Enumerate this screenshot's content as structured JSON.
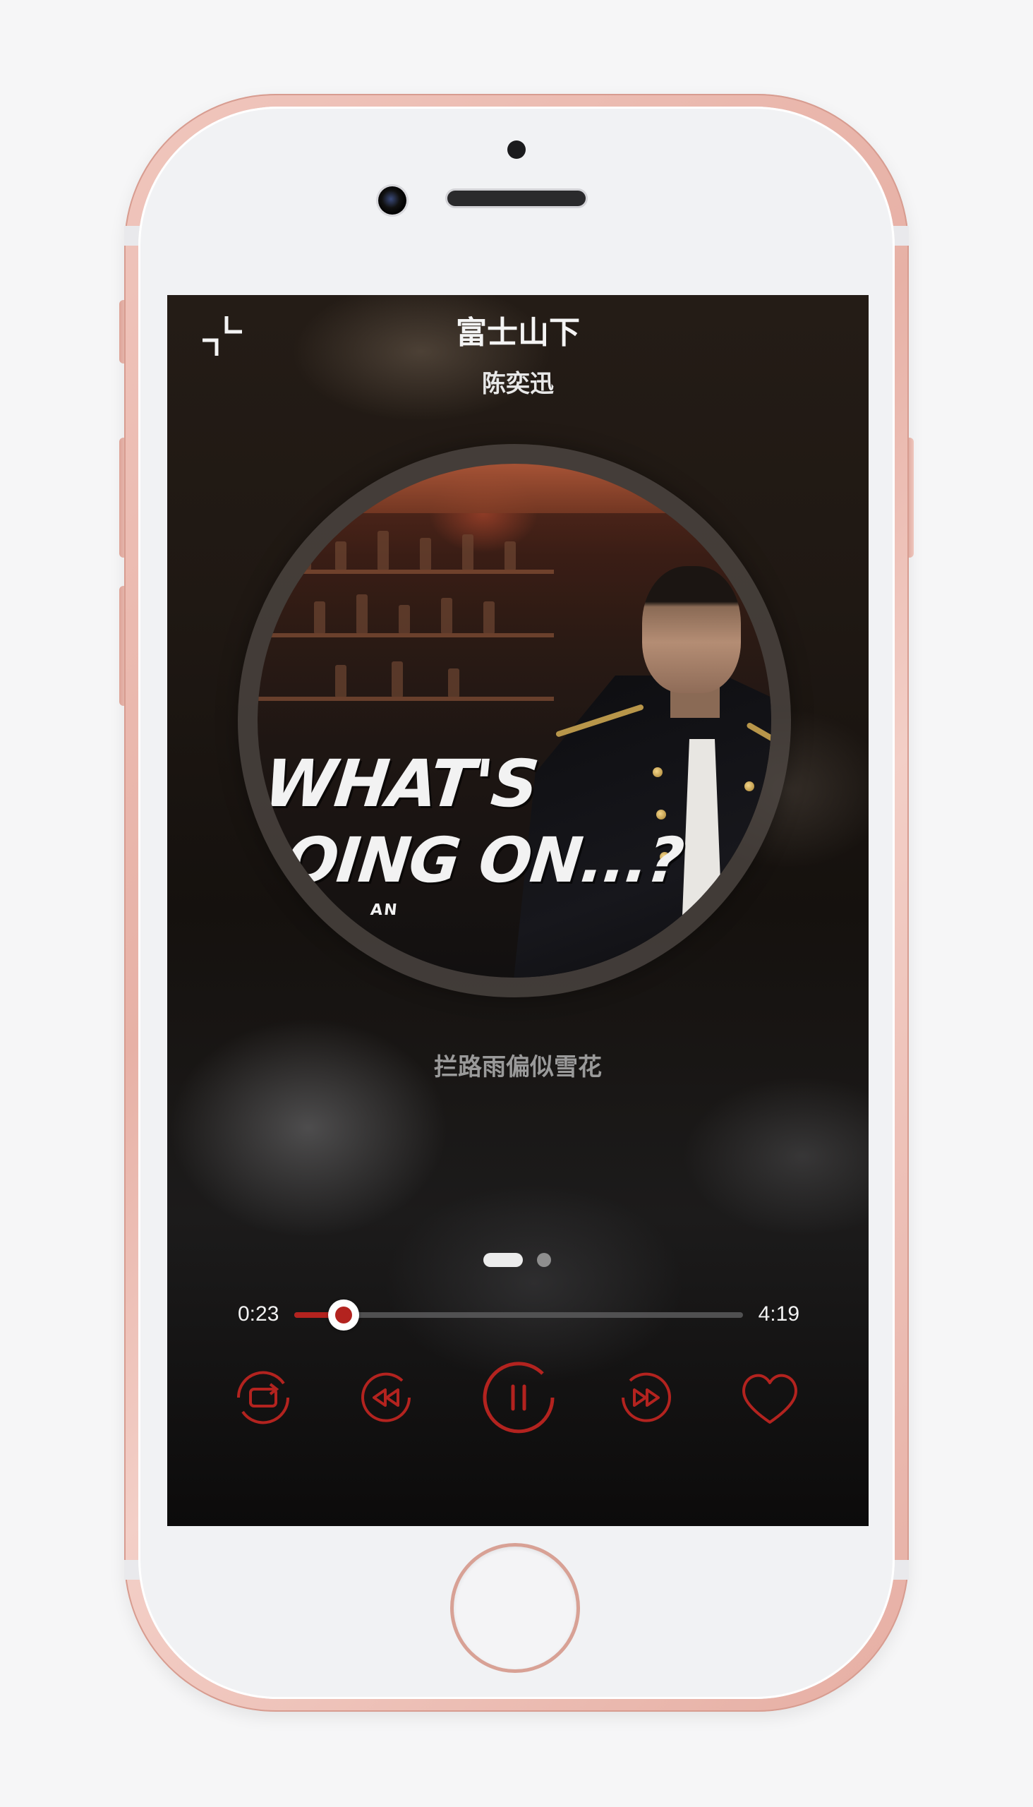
{
  "player": {
    "title": "富士山下",
    "artist": "陈奕迅",
    "lyric": "拦路雨偏似雪花",
    "album_art_text_line1": "WHAT'S",
    "album_art_text_line2": "OING ON...?",
    "album_art_text_small": "AN"
  },
  "playback": {
    "elapsed": "0:23",
    "duration": "4:19",
    "progress_fraction": 0.11,
    "state": "playing"
  },
  "pager": {
    "pages": 2,
    "active_index": 0
  },
  "controls": {
    "items": [
      "repeat-icon",
      "rewind-icon",
      "pause-icon",
      "fast-forward-icon",
      "heart-icon"
    ]
  },
  "colors": {
    "accent": "#b3231f",
    "phone_body": "#e7b1a6",
    "screen_bg": "#1a1512"
  }
}
